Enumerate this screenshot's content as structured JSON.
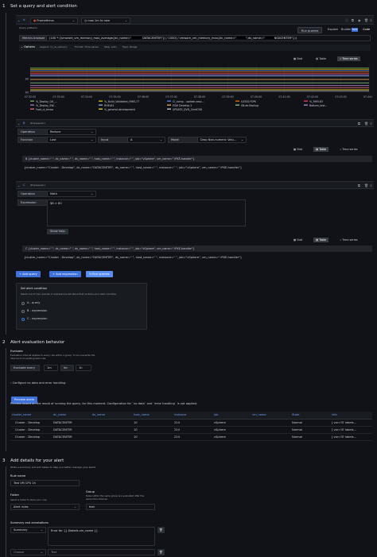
{
  "section1": {
    "num": "1",
    "title": "Set a query and alert condition"
  },
  "queryA": {
    "letter": "A",
    "datasource": "Prometheus",
    "time_range": "now-1m to now",
    "options_label": "Query patterns",
    "run_queries": "Run queries",
    "mode_explain": "Explain",
    "mode_builder": "Builder",
    "mode_code": "Code",
    "beta": "Beta",
    "metrics_browser": "Metrics browser",
    "expr_pre": "(100 * ((vmware_vm_memory_max_average{dc_name=\"",
    "expr_mid1": "DATACENTER\"}) / 1000) / vmware_vm_memory_max{dc_name=\"",
    "expr_mid2": "\",ds_name=\"",
    "expr_end": "NSXCENTER\"}))",
    "opt_options": "Options",
    "opt_legend": "Legend: {{_le_name}}",
    "opt_format": "Format: Time series",
    "opt_step": "Step: auto",
    "opt_type": "Type: Range"
  },
  "viewtabs": {
    "stat": "Stat",
    "table": "Table",
    "timeseries": "Time series"
  },
  "chart_data": {
    "type": "line",
    "x": [
      "07:32:00",
      "07:33:00",
      "07:34:00",
      "07:35:00",
      "07:36:00",
      "07:37:00",
      "07:38:00",
      "07:39:00",
      "07:40:00",
      "07:41:00",
      "07:42:00",
      "07:43:00",
      "07:44:00"
    ],
    "yticks": [
      "80",
      "60"
    ],
    "legend": [
      "%_Deploy_Gtl_...",
      "%_Build_Validation_RHEL77",
      "CI_comp - update-vesx...",
      "ILESS1YSPK",
      "%_RHEL83",
      "%_Deploy_SW...",
      "RHEL81",
      "ESXI Develop 2",
      "SN.eb Backup",
      "Bottom_test...",
      "Foot_ui_tmwa",
      "%_general-development",
      "UPDATE_DVD_CentOS8"
    ],
    "series": [
      {
        "color": "#73bf69",
        "values": [
          96,
          96,
          96,
          96,
          96,
          96,
          96,
          96,
          96,
          96,
          96,
          96,
          96
        ]
      },
      {
        "color": "#f2cc0c",
        "values": [
          94,
          94,
          94,
          94,
          94,
          94,
          94,
          94,
          94,
          94,
          94,
          94,
          94
        ]
      },
      {
        "color": "#5794f2",
        "values": [
          92,
          92,
          92,
          92,
          92,
          92,
          92,
          92,
          92,
          92,
          92,
          92,
          92
        ]
      },
      {
        "color": "#ff780a",
        "values": [
          90,
          90,
          90,
          90,
          90,
          90,
          90,
          90,
          90,
          90,
          90,
          90,
          90
        ]
      },
      {
        "color": "#f2495c",
        "values": [
          88,
          88,
          88,
          88,
          88,
          88,
          88,
          88,
          88,
          88,
          88,
          88,
          88
        ]
      },
      {
        "color": "#b877d9",
        "values": [
          86,
          86,
          86,
          86,
          86,
          86,
          86,
          86,
          86,
          86,
          86,
          86,
          86
        ]
      },
      {
        "color": "#8ab8ff",
        "values": [
          84,
          84,
          84,
          84,
          84,
          84,
          84,
          84,
          84,
          84,
          84,
          84,
          84
        ]
      },
      {
        "color": "#ffb357",
        "values": [
          79,
          79,
          79,
          79,
          79,
          79,
          79,
          79,
          79,
          79,
          79,
          79,
          79
        ]
      },
      {
        "color": "#96d98d",
        "values": [
          74,
          74,
          74,
          74,
          74,
          74,
          74,
          74,
          74,
          74,
          74,
          74,
          74
        ]
      },
      {
        "color": "#ca95e5",
        "values": [
          70,
          70,
          70,
          70,
          70,
          70,
          70,
          70,
          70,
          70,
          70,
          70,
          70
        ]
      },
      {
        "color": "#ff7383",
        "values": [
          67,
          67,
          67,
          67,
          67,
          67,
          67,
          67,
          67,
          67,
          67,
          67,
          67
        ]
      },
      {
        "color": "#fade2a",
        "values": [
          64,
          64,
          64,
          64,
          64,
          64,
          64,
          64,
          64,
          64,
          64,
          64,
          64
        ]
      },
      {
        "color": "#e0e0e0",
        "values": [
          62,
          62,
          62,
          62,
          62,
          62,
          62,
          62,
          62,
          62,
          62,
          62,
          62
        ]
      }
    ],
    "ylim": [
      58,
      100
    ]
  },
  "exprB": {
    "letter": "B",
    "type_label": "(Expression)",
    "operation_label": "Operation",
    "operation_value": "Reduce",
    "function_label": "Function",
    "function_value": "Last",
    "input_label": "Input",
    "input_value": "A",
    "mode_label": "Mode",
    "mode_value": "Drop Non-numeric Valu...",
    "result1": "B {cluster_name=\"           \", dc_name=\"           \", ds_name=\"           \", host_name=\"           \", instance=\"           \", job=\"vSphere\", vm_name=\"           iPXE-handler\"}",
    "result2": "{cluster_name=\"Cluster - Develop\", dc_name=\"DATACENTER\", ds_name=\"           \", host_name=\"           \", instance=\"           \", job=\"vSphere\", vm_name=\"           iPXE-handler\"}"
  },
  "exprC": {
    "letter": "C",
    "type_label": "(Expression)",
    "operation_label": "Operation",
    "operation_value": "Math",
    "expression_label": "Expression",
    "expression_value": "$B > 80",
    "show_help": "Show help",
    "result1": "C {cluster_name=\"           \", dc_name=\"           \", ds_name=\"           \", host_name=\"           \", instance=\"           \", job=\"vSphere\", vm_name=\"           iPXE-handler\"}",
    "result2": "{cluster_name=\"Cluster - Develop\", dc_name=\"DATACENTER\", ds_name=\"           \", host_name=\"           \", instance=\"           \", job=\"vSphere\", vm_name=\"           iPXE-handler\"}"
  },
  "actions": {
    "add_query": "+ Add query",
    "add_expression": "+ Add expression",
    "run_queries": "Run queries"
  },
  "condition": {
    "title": "Set alert condition",
    "desc": "Select one of your queries or expressions set above that contains your alert condition.",
    "options": [
      "A - query",
      "B - expression",
      "C - expression"
    ],
    "selected": 2
  },
  "section2": {
    "num": "2",
    "title": "Alert evaluation behavior",
    "evaluate": "Evaluate",
    "desc": "Evaluation interval applies to every rule within a group. It can overwrite the interval of an existing alert rule.",
    "every_label": "Evaluate every",
    "every_value": "1m",
    "for_label": "for",
    "for_value": "1h",
    "nodata": "Configure no data and error handling"
  },
  "preview": {
    "button": "Preview alerts",
    "note": "Preview based on the result of running the query, for this moment. Configuration for `no data` and `error handling` is not applied.",
    "columns": [
      "cluster_name",
      "dc_name",
      "ds_name",
      "host_name",
      "instance",
      "job",
      "vm_name",
      "State",
      "info"
    ],
    "rows": [
      [
        "Cluster - Develop",
        "DATACENTER",
        "",
        "10",
        "224",
        "vSphere",
        "",
        "Normal",
        "[ var='B' labels..."
      ],
      [
        "Cluster - Develop",
        "DATACENTER",
        "",
        "10",
        "224",
        "vSphere",
        "",
        "Normal",
        "[ var='B' labels..."
      ],
      [
        "Cluster - Develop",
        "DATACENTER",
        "",
        "10",
        "224",
        "vSphere",
        "",
        "Normal",
        "[ var='B' labels..."
      ]
    ]
  },
  "section3": {
    "num": "3",
    "title": "Add details for your alert",
    "subtitle": "Write a summary and add labels to help you better manage your alerts",
    "rule_name_label": "Rule name",
    "rule_name_value": "Test VM CPU 1h",
    "folder_label": "Folder",
    "folder_desc": "Select a folder to store your rule.",
    "folder_value": "Alert rules",
    "group_label": "Group",
    "group_desc": "Rules within the same group are evaluated after the same time interval.",
    "group_value": "test",
    "annotations_label": "Summary and annotations",
    "summary_select": "Summary",
    "summary_value": "Error for {{ $labels.vm_name }}",
    "choose_select": "Choose",
    "text_placeholder": "Text"
  }
}
